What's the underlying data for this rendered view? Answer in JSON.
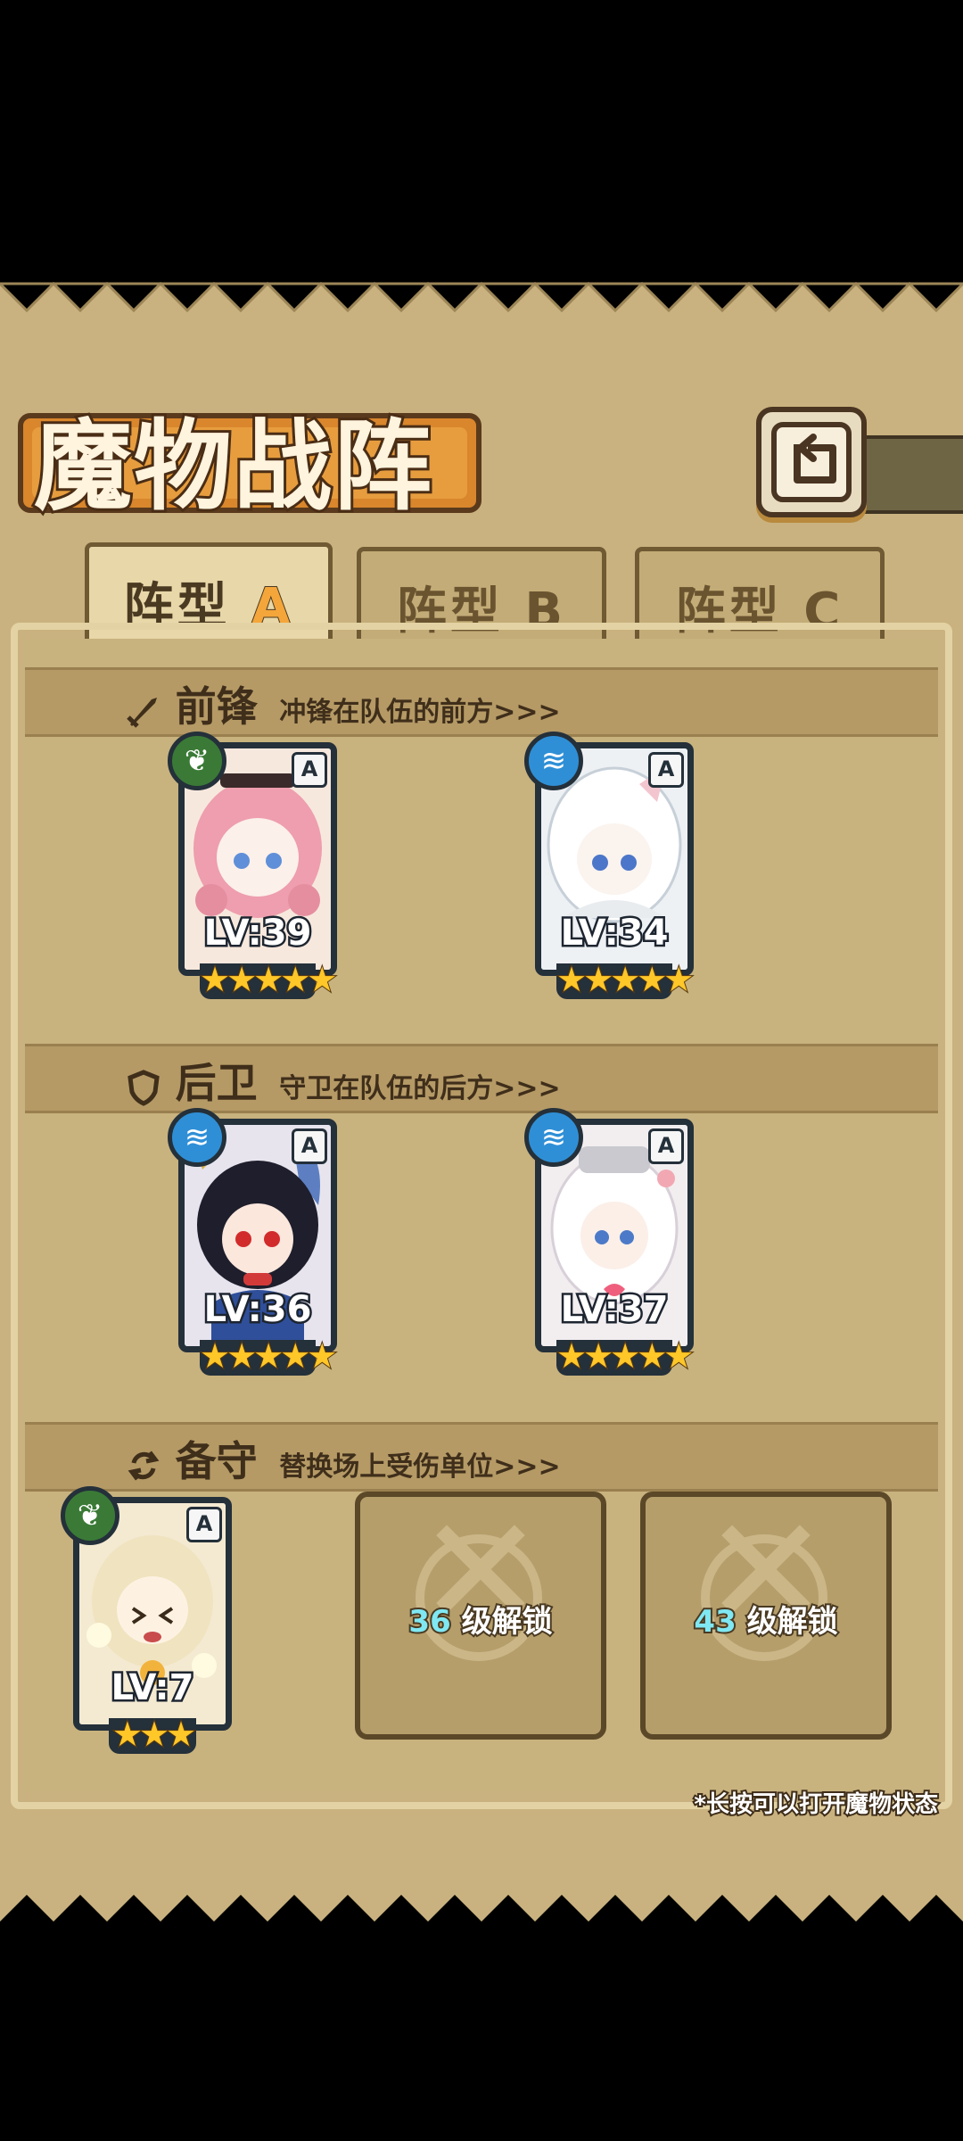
{
  "title": "魔物战阵",
  "back_button": {
    "icon": "return-arrow-icon"
  },
  "tabs": [
    {
      "label": "阵型",
      "letter": "A",
      "active": true
    },
    {
      "label": "阵型",
      "letter": "B",
      "active": false
    },
    {
      "label": "阵型",
      "letter": "C",
      "active": false
    }
  ],
  "sections": {
    "front": {
      "title": "前锋",
      "subtitle": "冲锋在队伍的前方>>>",
      "icon": "sword-icon"
    },
    "back": {
      "title": "后卫",
      "subtitle": "守卫在队伍的后方>>>",
      "icon": "shield-icon"
    },
    "reserve": {
      "title": "备守",
      "subtitle": "替换场上受伤单位>>>",
      "icon": "swap-icon"
    }
  },
  "monsters": {
    "front1": {
      "level": "LV:39",
      "rank": "A",
      "element": "leaf",
      "stars": "★★★★★",
      "star_count": 5
    },
    "front2": {
      "level": "LV:34",
      "rank": "A",
      "element": "water",
      "stars": "★★★★★",
      "star_count": 5
    },
    "back1": {
      "level": "LV:36",
      "rank": "A",
      "element": "water",
      "stars": "★★★★★",
      "star_count": 5
    },
    "back2": {
      "level": "LV:37",
      "rank": "A",
      "element": "water",
      "stars": "★★★★★",
      "star_count": 5
    },
    "reserve1": {
      "level": "LV:7",
      "rank": "A",
      "element": "leaf",
      "stars": "★★★",
      "star_count": 3
    }
  },
  "locked_slots": [
    {
      "level": "36",
      "label": "级解锁"
    },
    {
      "level": "43",
      "label": "级解锁"
    }
  ],
  "footer_note": "*长按可以打开魔物状态",
  "colors": {
    "accent_orange": "#e79d3e",
    "card_border": "#24303a",
    "card_glow": "#6fcfe6",
    "star": "#ffc728",
    "leaf": "#3a7a36",
    "water": "#2f8fd6"
  }
}
